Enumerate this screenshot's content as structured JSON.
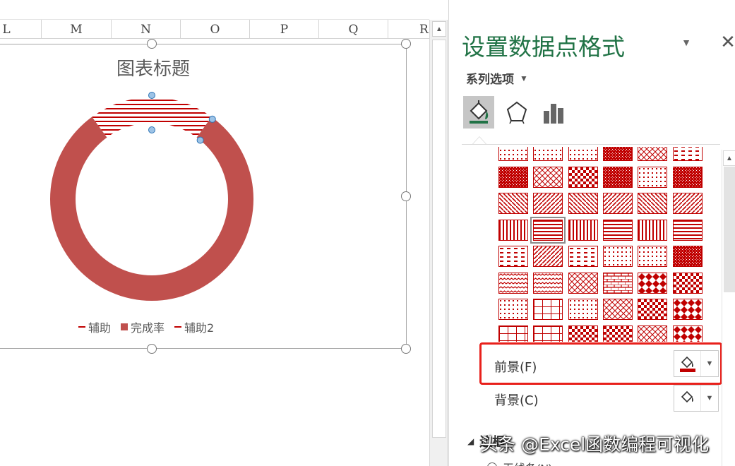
{
  "sheet": {
    "columns": [
      "L",
      "M",
      "N",
      "O",
      "P",
      "Q",
      "R"
    ]
  },
  "chart": {
    "title": "图表标题",
    "legend": [
      {
        "name": "辅助",
        "marker": "line"
      },
      {
        "name": "完成率",
        "marker": "box"
      },
      {
        "name": "辅助2",
        "marker": "line"
      }
    ]
  },
  "chart_data": {
    "type": "donut",
    "title": "图表标题",
    "series": [
      {
        "name": "完成率",
        "values": [
          0.8,
          0.2
        ],
        "fill": "#c0504d"
      },
      {
        "name": "辅助",
        "values": [
          0.2
        ],
        "fill": "horizontal-pattern"
      }
    ],
    "legend_position": "bottom"
  },
  "pane": {
    "title": "设置数据点格式",
    "series_options": "系列选项",
    "tabs": [
      "fill-line-icon",
      "effects-icon",
      "series-options-icon"
    ],
    "foreground_label": "前景(F)",
    "background_label": "背景(C)",
    "border_section": "边框",
    "no_line_label": "无线条(N)"
  },
  "colors": {
    "accent_green": "#217346",
    "pattern_red": "#c00000",
    "series_fill": "#c0504d",
    "highlight_red": "#e8201b"
  },
  "watermark": "头条 @Excel函数编程可视化"
}
